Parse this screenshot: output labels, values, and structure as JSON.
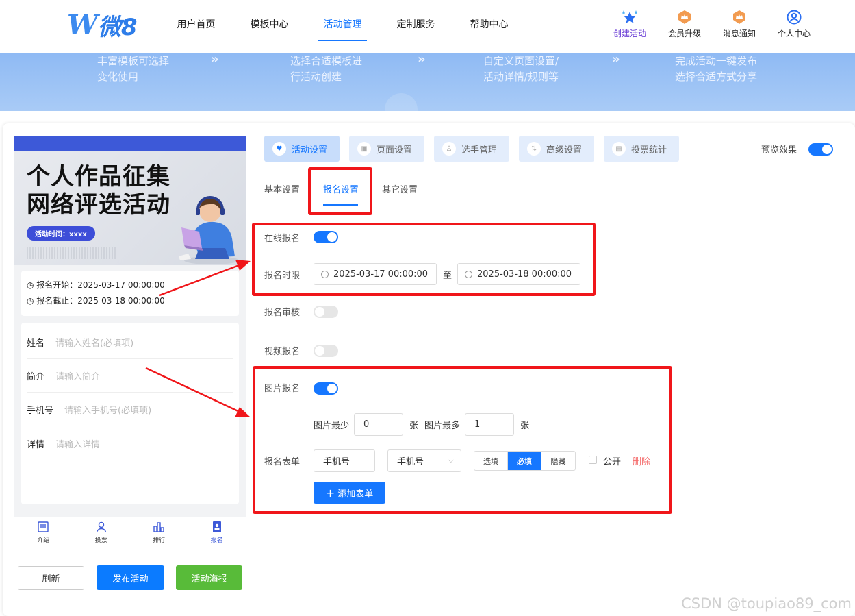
{
  "logo": {
    "w": "W",
    "text": "微8"
  },
  "nav": {
    "links": [
      "用户首页",
      "模板中心",
      "活动管理",
      "定制服务",
      "帮助中心"
    ]
  },
  "rightnav": {
    "create": "创建活动",
    "member": "会员升级",
    "notify": "消息通知",
    "profile": "个人中心"
  },
  "banner": {
    "steps": [
      {
        "l1": "丰富模板可选择",
        "l2": "变化使用"
      },
      {
        "l1": "选择合适模板进",
        "l2": "行活动创建"
      },
      {
        "l1": "自定义页面设置/",
        "l2": "活动详情/规则等"
      },
      {
        "l1": "完成活动一键发布",
        "l2": "选择合适方式分享"
      }
    ]
  },
  "phone": {
    "title1": "个人作品征集",
    "title2": "网络评选活动",
    "pill": "活动时间：xxxx",
    "start": "报名开始：2025-03-17 00:00:00",
    "end": "报名截止：2025-03-18 00:00:00",
    "form": [
      {
        "label": "姓名",
        "placeholder": "请输入姓名(必填项)"
      },
      {
        "label": "简介",
        "placeholder": "请输入简介"
      },
      {
        "label": "手机号",
        "placeholder": "请输入手机号(必填项)"
      },
      {
        "label": "详情",
        "placeholder": "请输入详情"
      }
    ],
    "bottom": [
      "介绍",
      "投票",
      "排行",
      "报名"
    ]
  },
  "buttons": {
    "refresh": "刷新",
    "publish": "发布活动",
    "poster": "活动海报"
  },
  "tabs": [
    "活动设置",
    "页面设置",
    "选手管理",
    "高级设置",
    "投票统计"
  ],
  "preview": "预览效果",
  "subtabs": [
    "基本设置",
    "报名设置",
    "其它设置"
  ],
  "settings": {
    "online": "在线报名",
    "period": "报名时限",
    "start_time": "2025-03-17 00:00:00",
    "to": "至",
    "end_time": "2025-03-18 00:00:00",
    "review": "报名审核",
    "video": "视频报名",
    "image": "图片报名",
    "img_min_label": "图片最少",
    "img_min": "0",
    "unit": "张",
    "img_max_label": "图片最多",
    "img_max": "1",
    "form_label": "报名表单",
    "field_name": "手机号",
    "field_type": "手机号",
    "seg": [
      "选填",
      "必填",
      "隐藏"
    ],
    "public": "公开",
    "delete": "删除",
    "add": "添加表单"
  },
  "toggles": {
    "online": true,
    "review": false,
    "video": false,
    "image": true,
    "preview": true
  },
  "colors": {
    "accent": "#1677ff",
    "annotation": "#f0161a",
    "publish": "#0b7bff",
    "poster": "#58bb39"
  },
  "watermark": "CSDN @toupiao89_com"
}
